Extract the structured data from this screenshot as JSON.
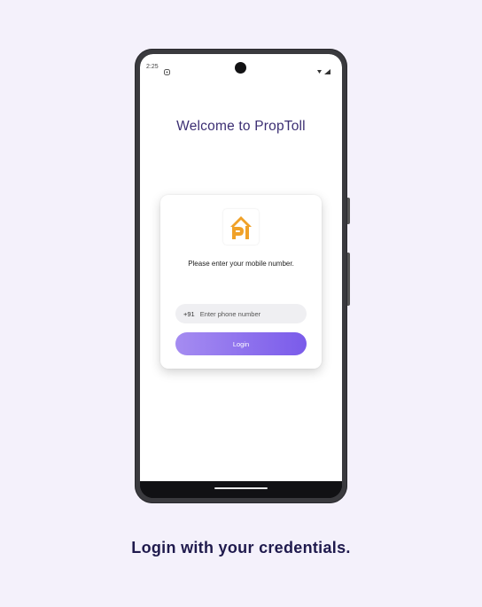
{
  "status_bar": {
    "time": "2:25"
  },
  "screen": {
    "welcome_title": "Welcome to PropToll",
    "logo_icon": "proptoll-logo-icon",
    "prompt_text": "Please enter your mobile number.",
    "country_code": "+91",
    "phone_placeholder": "Enter phone number",
    "login_label": "Login"
  },
  "caption": "Login with your credentials.",
  "colors": {
    "background": "#f4f1fb",
    "title": "#3c2f73",
    "button_start": "#a58cf1",
    "button_end": "#7a5bea",
    "logo": "#f0a128",
    "caption": "#1f1a4d"
  }
}
